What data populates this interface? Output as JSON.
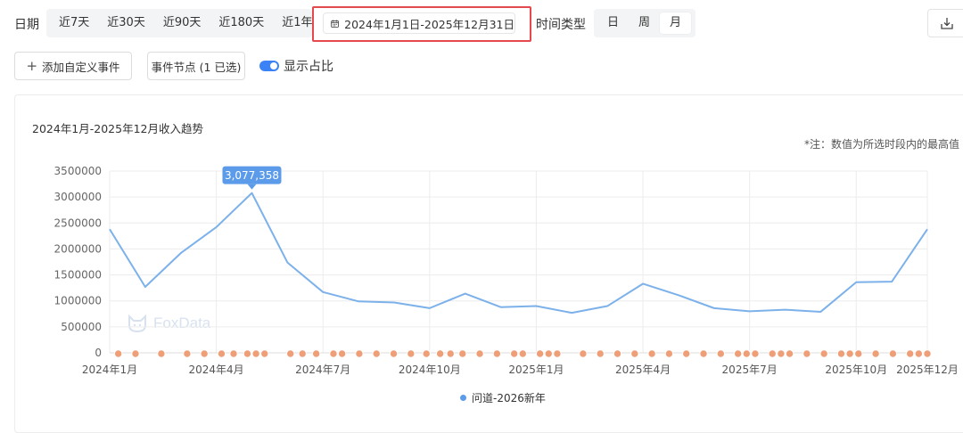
{
  "toolbar": {
    "date_label": "日期",
    "ranges": [
      "近7天",
      "近30天",
      "近90天",
      "近180天",
      "近1年"
    ],
    "date_range_value": "2024年1月1日-2025年12月31日",
    "time_type_label": "时间类型",
    "time_types": [
      {
        "label": "日",
        "active": false
      },
      {
        "label": "周",
        "active": false
      },
      {
        "label": "月",
        "active": true
      }
    ]
  },
  "actions": {
    "add_event_label": "添加自定义事件",
    "event_node_label": "事件节点 (1 已选)",
    "show_ratio_label": "显示占比",
    "show_ratio_on": true
  },
  "watermark_text": "FoxData",
  "chart_data": {
    "type": "line",
    "title": "2024年1月-2025年12月收入趋势",
    "note": "*注：数值为所选时段内的最高值",
    "ylim": [
      0,
      3500000
    ],
    "y_ticks": [
      "3500000",
      "3000000",
      "2500000",
      "2000000",
      "1500000",
      "1000000",
      "500000",
      "0"
    ],
    "x_tick_labels": [
      "2024年1月",
      "2024年4月",
      "2024年7月",
      "2024年10月",
      "2025年1月",
      "2025年4月",
      "2025年7月",
      "2025年10月",
      "2025年12月"
    ],
    "x_tick_indices": [
      0,
      3,
      6,
      9,
      12,
      15,
      18,
      21,
      23
    ],
    "categories": [
      "2024-01",
      "2024-02",
      "2024-03",
      "2024-04",
      "2024-05",
      "2024-06",
      "2024-07",
      "2024-08",
      "2024-09",
      "2024-10",
      "2024-11",
      "2024-12",
      "2025-01",
      "2025-02",
      "2025-03",
      "2025-04",
      "2025-05",
      "2025-06",
      "2025-07",
      "2025-08",
      "2025-09",
      "2025-10",
      "2025-11",
      "2025-12"
    ],
    "series": [
      {
        "name": "问道-2026新年",
        "color": "#7cb1ea",
        "values": [
          2380000,
          1270000,
          1920000,
          2420000,
          3077358,
          1740000,
          1170000,
          990000,
          970000,
          860000,
          1140000,
          880000,
          900000,
          770000,
          900000,
          1330000,
          1110000,
          860000,
          800000,
          830000,
          790000,
          1360000,
          1370000,
          2380000
        ]
      }
    ],
    "highlight": {
      "index": 4,
      "label": "3,077,358"
    },
    "grid": true,
    "legend": "bottom",
    "event_marker_color": "#ef9f78",
    "event_markers": [
      0.5,
      1.5,
      3.0,
      4.5,
      5.5,
      6.5,
      7.2,
      8.0,
      8.5,
      9.0,
      10.5,
      11.2,
      12.0,
      13.0,
      13.5,
      14.5,
      15.5,
      16.5,
      17.5,
      18.4,
      19.2,
      19.8,
      20.5,
      21.5,
      22.5,
      23.5,
      24.0,
      25.0,
      25.5,
      26.0,
      27.5,
      28.5,
      29.5,
      30.5,
      31.5,
      32.5,
      33.5,
      34.5,
      35.5,
      36.5,
      37.0,
      37.5,
      38.5,
      39.0,
      39.5,
      40.5,
      41.5,
      42.5,
      43.0,
      43.5,
      44.5,
      45.5,
      46.5,
      47.0,
      47.5
    ]
  }
}
